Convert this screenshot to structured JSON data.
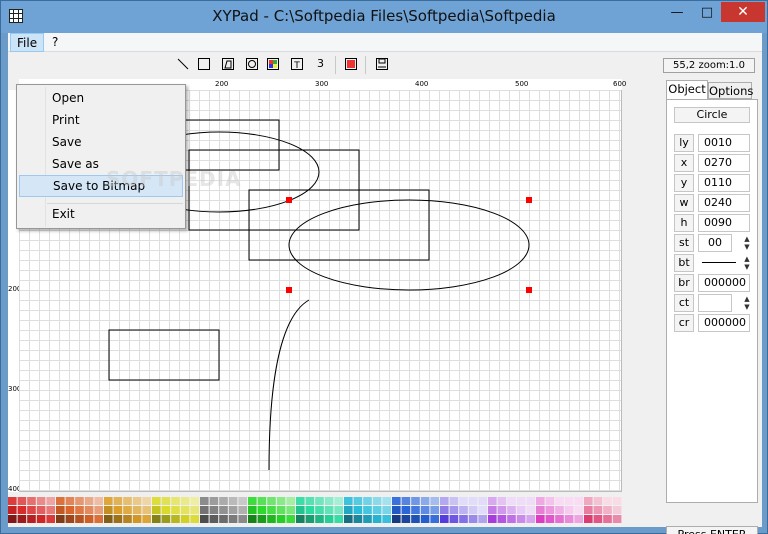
{
  "window": {
    "title": "XYPad - C:\\Softpedia Files\\Softpedia\\Softpedia"
  },
  "menubar": {
    "file": "File",
    "help": "?"
  },
  "file_menu": {
    "items": [
      "Open",
      "Print",
      "Save",
      "Save as",
      "Save to Bitmap",
      "Exit"
    ],
    "highlighted": "Save to Bitmap"
  },
  "toolbar": {
    "line_width": "3",
    "zoom": "55,2 zoom:1.0"
  },
  "ruler": {
    "top": [
      "200",
      "300",
      "400",
      "500",
      "600"
    ],
    "left": [
      "200",
      "300",
      "400"
    ]
  },
  "panel": {
    "tabs": [
      "Object",
      "Options"
    ],
    "active_tab": "Object",
    "shape": "Circle",
    "props": [
      {
        "label": "ly",
        "value": "0010"
      },
      {
        "label": "x",
        "value": "0270"
      },
      {
        "label": "y",
        "value": "0110"
      },
      {
        "label": "w",
        "value": "0240"
      },
      {
        "label": "h",
        "value": "0090"
      },
      {
        "label": "st",
        "value": "00"
      },
      {
        "label": "bt",
        "value": ""
      },
      {
        "label": "br",
        "value": "000000"
      },
      {
        "label": "ct",
        "value": ""
      },
      {
        "label": "cr",
        "value": "000000"
      }
    ],
    "status": "Press ENTER"
  },
  "watermark": "SOFTPEDIA",
  "colors": {
    "selection_handle": "#ff0000",
    "accent": "#cce4f7",
    "close": "#c7372f"
  }
}
